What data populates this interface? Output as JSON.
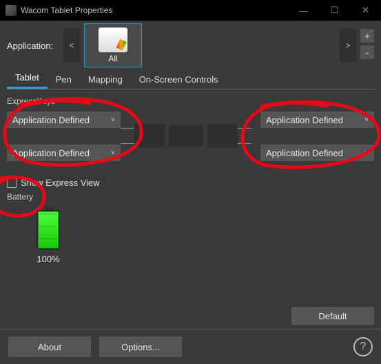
{
  "window": {
    "title": "Wacom Tablet Properties"
  },
  "application": {
    "label": "Application:",
    "prev": "<",
    "next": ">",
    "tile_caption": "All",
    "plus": "+",
    "minus": "-"
  },
  "tabs": {
    "tablet": "Tablet",
    "pen": "Pen",
    "mapping": "Mapping",
    "osc": "On-Screen Controls",
    "active": "tablet"
  },
  "expresskeys": {
    "heading": "ExpressKeys",
    "left1": "Application Defined",
    "left2": "Application Defined",
    "right1": "Application Defined",
    "right2": "Application Defined"
  },
  "show_express_view": {
    "label": "Show Express View",
    "checked": false
  },
  "battery": {
    "heading": "Battery",
    "percent_label": "100%",
    "percent": 100
  },
  "buttons": {
    "default": "Default",
    "about": "About",
    "options": "Options..."
  },
  "icons": {
    "chevron": "˅",
    "help": "?",
    "min": "—",
    "max": "☐",
    "close": "✕"
  }
}
